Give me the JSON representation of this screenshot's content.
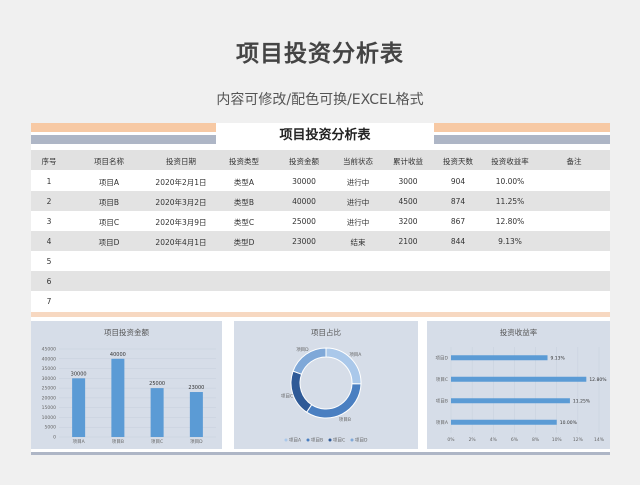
{
  "header": {
    "title": "项目投资分析表",
    "subtitle": "内容可修改/配色可换/EXCEL格式"
  },
  "sheet": {
    "title": "项目投资分析表",
    "columns": [
      "序号",
      "项目名称",
      "投资日期",
      "投资类型",
      "投资金额",
      "当前状态",
      "累计收益",
      "投资天数",
      "投资收益率",
      "备注"
    ],
    "rows": [
      [
        "1",
        "项目A",
        "2020年2月1日",
        "类型A",
        "30000",
        "进行中",
        "3000",
        "904",
        "10.00%",
        ""
      ],
      [
        "2",
        "项目B",
        "2020年3月2日",
        "类型B",
        "40000",
        "进行中",
        "4500",
        "874",
        "11.25%",
        ""
      ],
      [
        "3",
        "项目C",
        "2020年3月9日",
        "类型C",
        "25000",
        "进行中",
        "3200",
        "867",
        "12.80%",
        ""
      ],
      [
        "4",
        "项目D",
        "2020年4月1日",
        "类型D",
        "23000",
        "结束",
        "2100",
        "844",
        "9.13%",
        ""
      ],
      [
        "5",
        "",
        "",
        "",
        "",
        "",
        "",
        "",
        "",
        ""
      ],
      [
        "6",
        "",
        "",
        "",
        "",
        "",
        "",
        "",
        "",
        ""
      ],
      [
        "7",
        "",
        "",
        "",
        "",
        "",
        "",
        "",
        "",
        ""
      ]
    ]
  },
  "colors": {
    "bar": "#5b9bd5",
    "peach": "#f7c9a4",
    "grey": "#aeb6c6",
    "panel": "#d6dde8",
    "donut": [
      "#aac8ea",
      "#4a7fc1",
      "#2f5a97",
      "#7fa8d8"
    ]
  },
  "chart_data": [
    {
      "type": "bar",
      "title": "项目投资金额",
      "categories": [
        "项目A",
        "项目B",
        "项目C",
        "项目D"
      ],
      "values": [
        30000,
        40000,
        25000,
        23000
      ],
      "yticks": [
        "0",
        "5000",
        "10000",
        "15000",
        "20000",
        "25000",
        "30000",
        "35000",
        "40000",
        "45000"
      ],
      "ylim": [
        0,
        45000
      ]
    },
    {
      "type": "pie",
      "title": "项目占比",
      "categories": [
        "项目A",
        "项目B",
        "项目C",
        "项目D"
      ],
      "values": [
        30000,
        40000,
        25000,
        23000
      ],
      "labels": [
        "项目A",
        "项目B",
        "项目C",
        "项目D"
      ]
    },
    {
      "type": "bar",
      "orientation": "horizontal",
      "title": "投资收益率",
      "categories": [
        "项目D",
        "项目C",
        "项目B",
        "项目A"
      ],
      "values": [
        9.13,
        12.8,
        11.25,
        10.0
      ],
      "value_labels": [
        "9.13%",
        "12.80%",
        "11.25%",
        "10.00%"
      ],
      "xticks": [
        "0%",
        "2%",
        "4%",
        "6%",
        "8%",
        "10%",
        "12%",
        "14%"
      ],
      "xlim": [
        0,
        14
      ]
    }
  ]
}
